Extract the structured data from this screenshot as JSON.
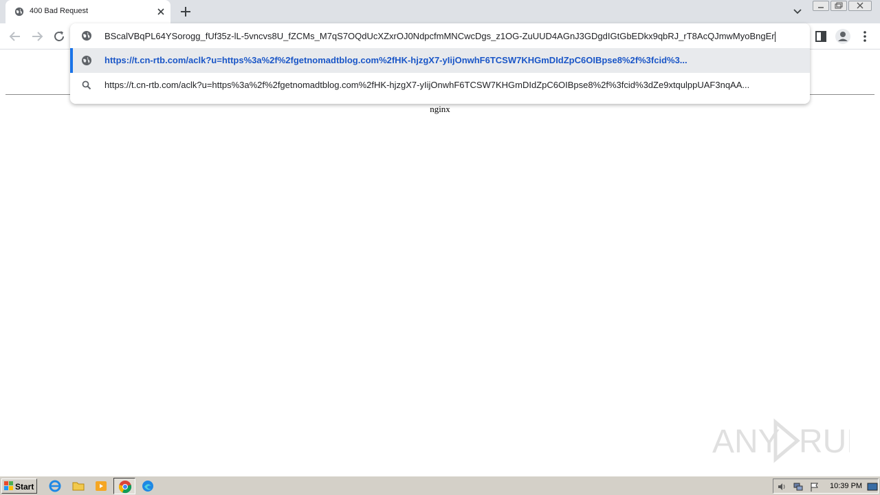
{
  "tab": {
    "title": "400 Bad Request",
    "favicon": "globe-icon"
  },
  "omnibox": {
    "input_text": "BScalVBqPL64YSorogg_fUf35z-lL-5vncvs8U_fZCMs_M7qS7OQdUcXZxrOJ0NdpcfmMNCwcDgs_z1OG-ZuUUD4AGnJ3GDgdIGtGbEDkx9qbRJ_rT8AcQJmwMyoBngEr",
    "suggestions": [
      {
        "text": "https://t.cn-rtb.com/aclk?u=https%3a%2f%2fgetnomadtblog.com%2fHK-hjzgX7-yIijOnwhF6TCSW7KHGmDIdZpC6OIBpse8%2f%3fcid%3...",
        "icon": "globe-icon"
      },
      {
        "text": "https://t.cn-rtb.com/aclk?u=https%3a%2f%2fgetnomadtblog.com%2fHK-hjzgX7-yIijOnwhF6TCSW7KHGmDIdZpC6OIBpse8%2f%3fcid%3dZe9xtqulppUAF3nqAA...",
        "icon": "search-icon"
      }
    ]
  },
  "page": {
    "server_text": "nginx"
  },
  "watermark": {
    "text": "ANY RUN"
  },
  "taskbar": {
    "start_label": "Start",
    "clock": "10:39 PM"
  },
  "colors": {
    "accent": "#1a73e8",
    "selected_text": "#1a56c7",
    "tabstrip": "#dee1e6",
    "taskbar": "#d4d0c8"
  }
}
